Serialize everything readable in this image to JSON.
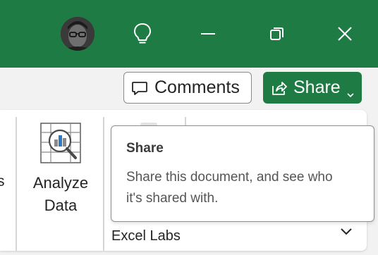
{
  "titlebar": {
    "background": "#1e7b43",
    "icons": [
      "avatar",
      "lightbulb-icon",
      "minimize-icon",
      "restore-icon",
      "close-icon"
    ]
  },
  "toolbar": {
    "comments_label": "Comments",
    "share_label": "Share"
  },
  "ribbon": {
    "cut_label": "s",
    "analyze_label_line1": "Analyze",
    "analyze_label_line2": "Data",
    "group_label": "Excel Labs"
  },
  "tooltip": {
    "title": "Share",
    "body_line1": "Share this document, and see who",
    "body_line2": "it's shared with."
  },
  "colors": {
    "accent": "#1e7b43",
    "ribbon_bg": "#ffffff",
    "page_bg": "#f2f2f2"
  }
}
